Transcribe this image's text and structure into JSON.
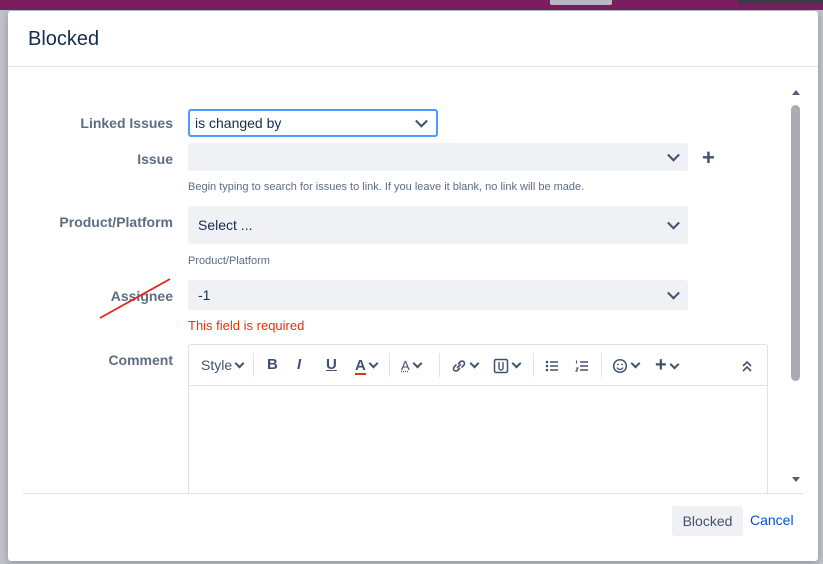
{
  "dialog": {
    "title": "Blocked"
  },
  "form": {
    "linked_issues": {
      "label": "Linked Issues",
      "value": "is changed by"
    },
    "issue": {
      "label": "Issue",
      "value": "",
      "help": "Begin typing to search for issues to link. If you leave it blank, no link will be made."
    },
    "product_platform": {
      "label": "Product/Platform",
      "placeholder": "Select ...",
      "help": "Product/Platform"
    },
    "assignee": {
      "label": "Assignee",
      "value": "-1",
      "error": "This field is required"
    },
    "comment": {
      "label": "Comment",
      "toolbar": {
        "style_label": "Style",
        "bold": "B",
        "italic": "I",
        "underline": "U",
        "text_color": "A",
        "more_formatting": "A",
        "icons": [
          "bold-icon",
          "italic-icon",
          "underline-icon",
          "text-color-icon",
          "more-formatting-icon",
          "link-icon",
          "attachment-icon",
          "bullet-list-icon",
          "numbered-list-icon",
          "emoji-icon",
          "insert-more-icon",
          "collapse-icon"
        ]
      }
    }
  },
  "footer": {
    "submit_label": "Blocked",
    "cancel_label": "Cancel"
  },
  "colors": {
    "accent": "#0052cc",
    "error": "#de350b",
    "focus": "#4c9aff",
    "annotation": "#e0261f"
  }
}
